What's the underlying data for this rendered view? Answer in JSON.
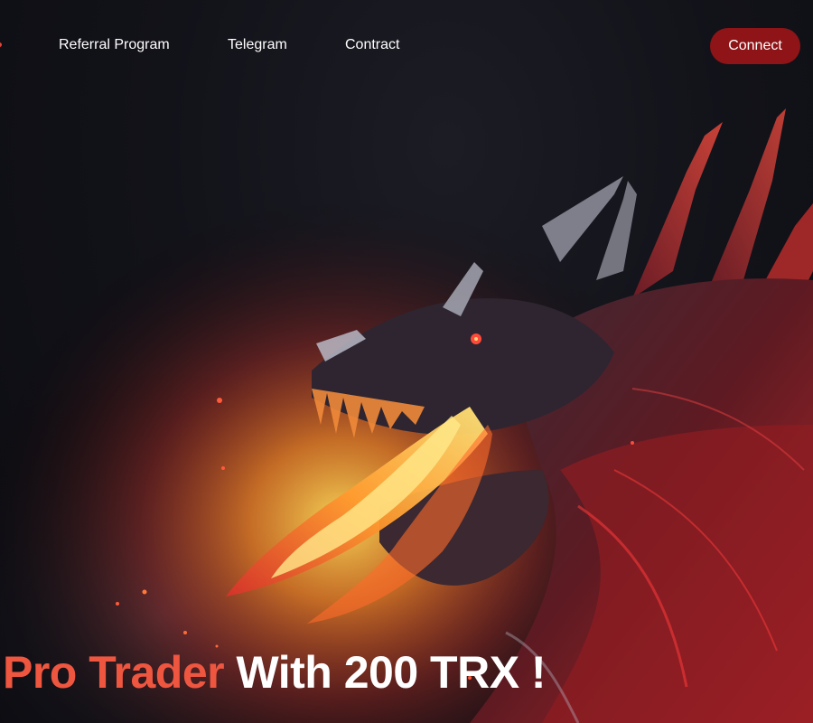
{
  "nav": {
    "links": [
      {
        "label": "Referral Program"
      },
      {
        "label": "Telegram"
      },
      {
        "label": "Contract"
      }
    ],
    "connect_label": "Connect"
  },
  "hero": {
    "headline_accent": "Pro Trader",
    "headline_rest": " With 200 TRX !",
    "art": "dragon-breathing-fire-illustration"
  },
  "colors": {
    "background": "#0f0f16",
    "accent": "#ee5640",
    "connect_button": "#8e1417",
    "text": "#ffffff"
  }
}
